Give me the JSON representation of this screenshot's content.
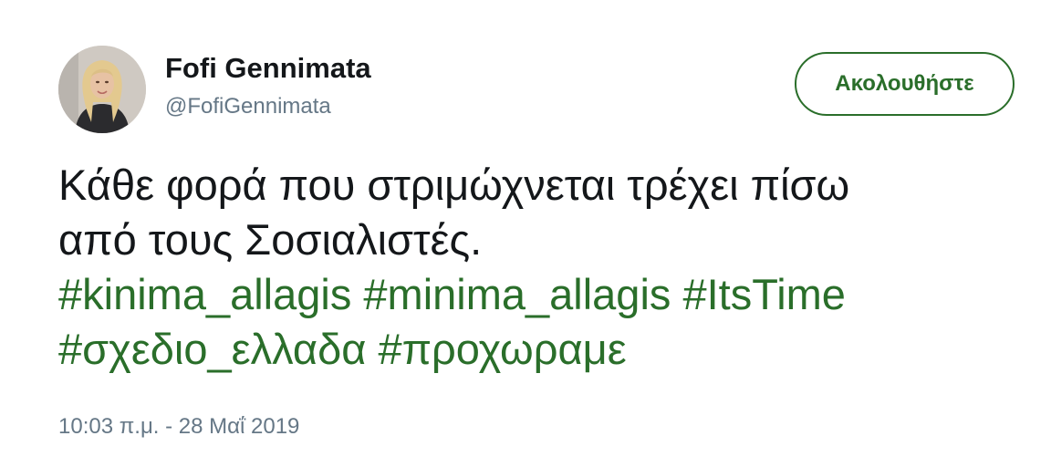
{
  "user": {
    "display_name": "Fofi Gennimata",
    "handle": "@FofiGennimata",
    "avatar_icon": "profile-photo"
  },
  "follow_button": {
    "label": "Ακολουθήστε",
    "color": "#2a6e2a"
  },
  "tweet": {
    "text_lines": [
      "Κάθε φορά που στριμώχνεται τρέχει πίσω",
      "από τους Σοσιαλιστές."
    ],
    "hashtags": [
      "#kinima_allagis",
      "#minima_allagis",
      "#ItsTime",
      "#σχεδιο_ελλαδα",
      "#προχωραμε"
    ],
    "hashtag_color": "#2a6e2a"
  },
  "timestamp": "10:03 π.μ. - 28 Μαΐ 2019"
}
